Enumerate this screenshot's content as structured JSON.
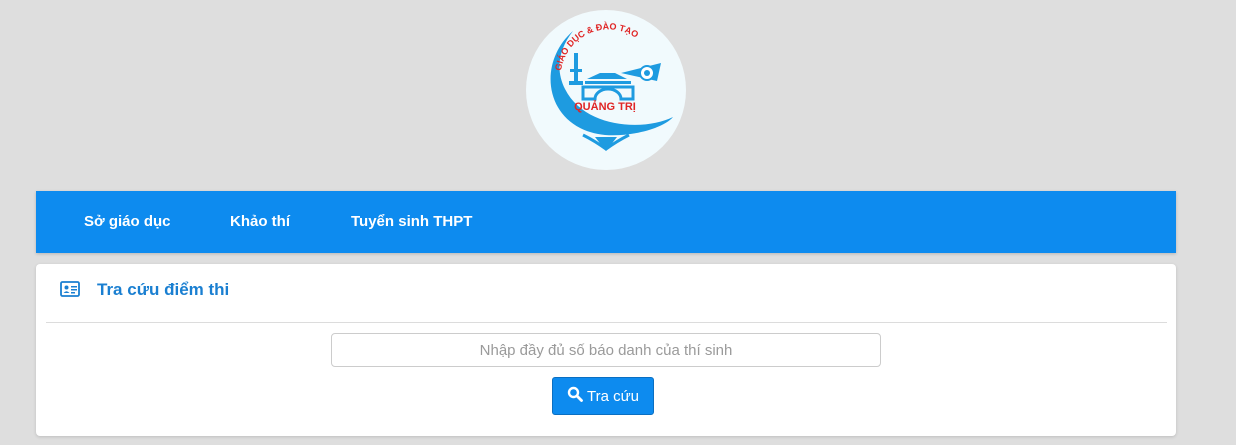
{
  "logo": {
    "arc_text": "GIÁO DỤC & ĐÀO TẠO",
    "place_text": "QUẢNG TRỊ",
    "colors": {
      "blue": "#1e9be0",
      "red": "#e02424",
      "bg": "#f1fafd"
    }
  },
  "nav": {
    "items": [
      {
        "label": "Sở giáo dục"
      },
      {
        "label": "Khảo thí"
      },
      {
        "label": "Tuyển sinh THPT"
      }
    ],
    "color": "#0d8bef"
  },
  "panel": {
    "icon": "id-card-icon",
    "title": "Tra cứu điểm thi",
    "search": {
      "value": "",
      "placeholder": "Nhập đầy đủ số báo danh của thí sinh"
    },
    "button": {
      "icon": "search-icon",
      "label": "Tra cứu"
    }
  }
}
